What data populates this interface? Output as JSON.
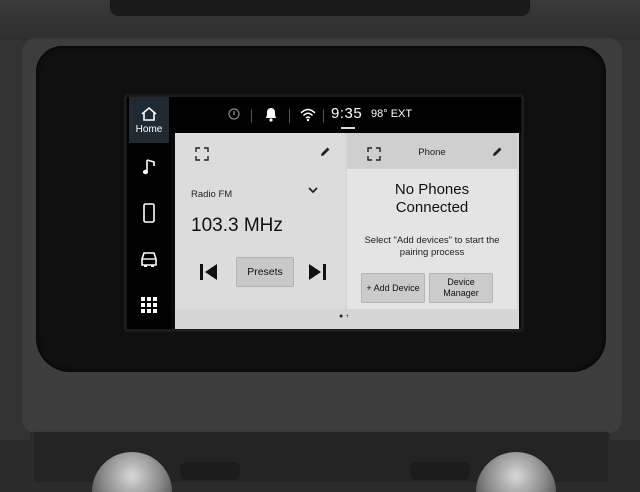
{
  "status_bar": {
    "time": "9:35",
    "temperature": "98° EXT",
    "icons": [
      "alert-icon",
      "bell-icon",
      "wifi-icon"
    ]
  },
  "sidebar": {
    "items": [
      {
        "label": "Home",
        "icon": "home-icon",
        "active": true
      },
      {
        "label": "",
        "icon": "music-icon"
      },
      {
        "label": "",
        "icon": "phone-icon"
      },
      {
        "label": "",
        "icon": "vehicle-icon"
      },
      {
        "label": "",
        "icon": "apps-grid-icon"
      }
    ]
  },
  "radio_card": {
    "source": "Radio FM",
    "frequency": "103.3 MHz",
    "presets_label": "Presets"
  },
  "phone_card": {
    "title": "Phone",
    "headline_line1": "No Phones",
    "headline_line2": "Connected",
    "message": "Select \"Add devices\" to start the pairing process",
    "add_device_label": "+ Add Device",
    "device_manager_line1": "Device",
    "device_manager_line2": "Manager"
  },
  "pager": {
    "pages": 2,
    "current": 1
  },
  "colors": {
    "screen_bg": "#000000",
    "card_bg": "#dcdcdc",
    "active_rail": "#1f2a33"
  }
}
